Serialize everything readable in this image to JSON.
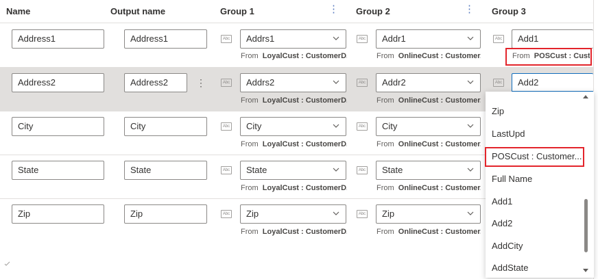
{
  "headers": {
    "name": "Name",
    "output_name": "Output name",
    "group1": "Group 1",
    "group2": "Group 2",
    "group3": "Group 3"
  },
  "more_glyph": "⋮",
  "abc_glyph": "Abc",
  "rows": [
    {
      "name": "Address1",
      "output": "Address1",
      "g1": "Addrs1",
      "g1_from_label": "From",
      "g1_from": "LoyalCust : CustomerD...",
      "g2": "Addr1",
      "g2_from_label": "From",
      "g2_from": "OnlineCust : Customer...",
      "g3": "Add1",
      "g3_from_label": "From",
      "g3_from": "POSCust : Custo"
    },
    {
      "name": "Address2",
      "output": "Address2",
      "g1": "Addrs2",
      "g1_from_label": "From",
      "g1_from": "LoyalCust : CustomerD...",
      "g2": "Addr2",
      "g2_from_label": "From",
      "g2_from": "OnlineCust : Customer...",
      "g3": "Add2"
    },
    {
      "name": "City",
      "output": "City",
      "g1": "City",
      "g1_from_label": "From",
      "g1_from": "LoyalCust : CustomerD...",
      "g2": "City",
      "g2_from_label": "From",
      "g2_from": "OnlineCust : Customer..."
    },
    {
      "name": "State",
      "output": "State",
      "g1": "State",
      "g1_from_label": "From",
      "g1_from": "LoyalCust : CustomerD...",
      "g2": "State",
      "g2_from_label": "From",
      "g2_from": "OnlineCust : Customer..."
    },
    {
      "name": "Zip",
      "output": "Zip",
      "g1": "Zip",
      "g1_from_label": "From",
      "g1_from": "LoyalCust : CustomerD...",
      "g2": "Zip",
      "g2_from_label": "From",
      "g2_from": "OnlineCust : Customer..."
    }
  ],
  "dropdown_menu": {
    "items": [
      "Zip",
      "LastUpd",
      "POSCust : Customer...",
      "Full Name",
      "Add1",
      "Add2",
      "AddCity",
      "AddState"
    ],
    "highlighted": "POSCust : Customer..."
  },
  "colors": {
    "highlight_border": "#e3242b",
    "focus_border": "#0f6cbd",
    "selected_row_bg": "#e1dfdd"
  },
  "icons": {
    "column_menu": "more-vertical-icon",
    "type": "text-type-icon",
    "dropdown": "chevron-down-icon"
  }
}
